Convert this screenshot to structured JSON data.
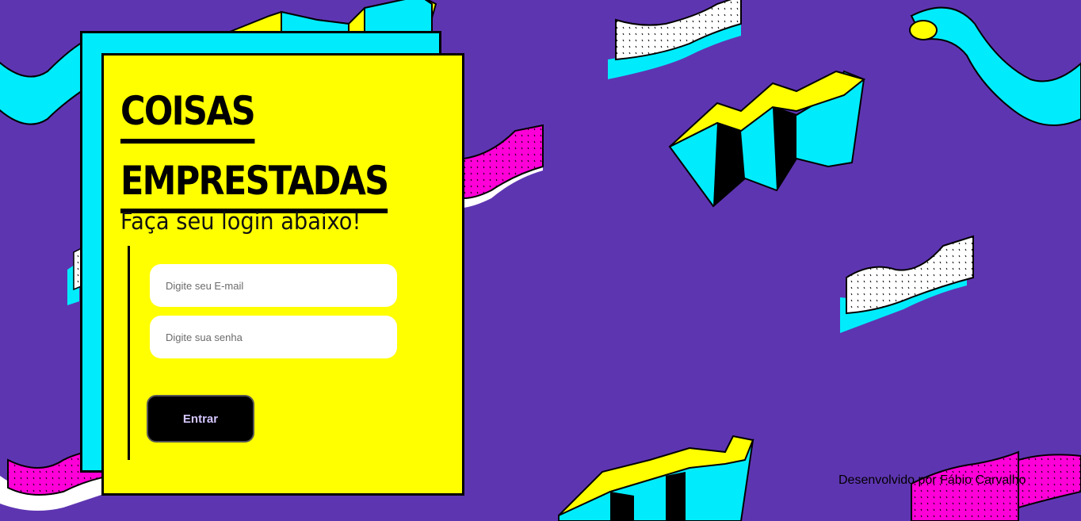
{
  "app": {
    "title_line1": "COISAS",
    "title_line2": "EMPRESTADAS",
    "subtitle": "Faça seu login abaixo!"
  },
  "form": {
    "email_placeholder": "Digite seu E-mail",
    "email_value": "",
    "password_placeholder": "Digite sua senha",
    "password_value": "",
    "submit_label": "Entrar"
  },
  "footer": {
    "credit": "Desenvolvido por Fábio Carvalho"
  },
  "theme": {
    "background": "#5e35b1",
    "card": "#ffff00",
    "card_shadow": "#00ecfc",
    "accent_pink": "#ff00d8",
    "accent_cyan": "#00ecfc",
    "button": "#000000"
  }
}
